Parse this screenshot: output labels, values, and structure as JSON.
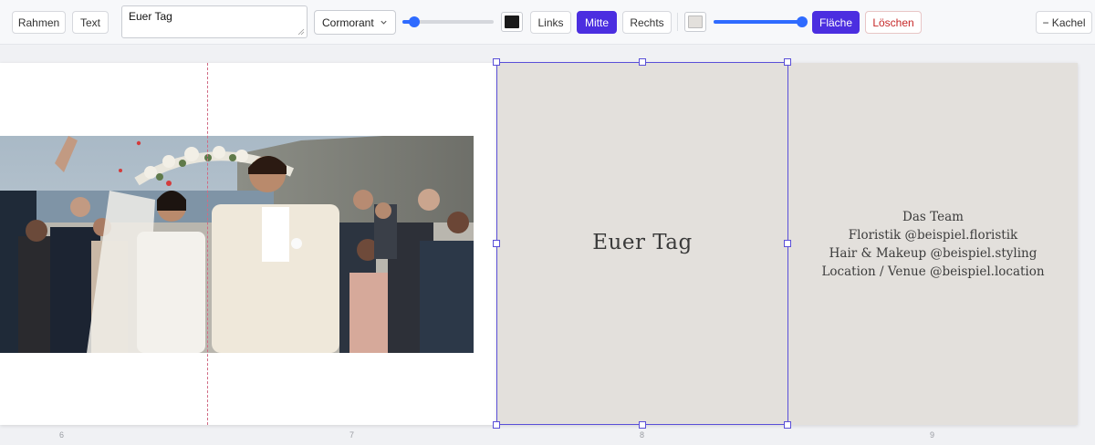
{
  "toolbar": {
    "frame_label": "Rahmen",
    "text_label": "Text",
    "text_value": "Euer Tag",
    "font_selected": "Cormorant",
    "font_size_level": 0.13,
    "text_color": "#1a1a1a",
    "align_left": "Links",
    "align_center": "Mitte",
    "align_right": "Rechts",
    "fill_color": "#e3e0dc",
    "fill_opacity_level": 0.96,
    "fill_label": "Fläche",
    "delete_label": "Löschen",
    "remove_tile_label": "− Kachel"
  },
  "canvas": {
    "title": "Euer Tag",
    "credits": [
      "Das Team",
      "Floristik @beispiel.floristik",
      "Hair & Makeup @beispiel.styling",
      "Location / Venue @beispiel.location"
    ],
    "page_numbers": [
      "6",
      "7",
      "8",
      "9"
    ],
    "accent_color": "#4b2ee0",
    "page_background": "#e3e0dc"
  }
}
